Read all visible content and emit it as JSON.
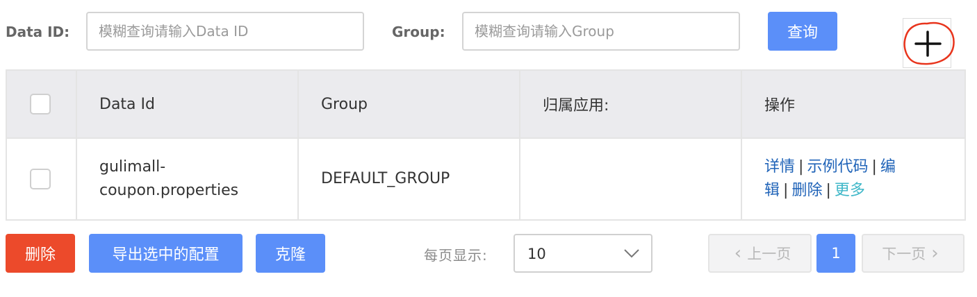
{
  "search": {
    "dataid_label": "Data ID:",
    "dataid_placeholder": "模糊查询请输入Data ID",
    "group_label": "Group:",
    "group_placeholder": "模糊查询请输入Group",
    "query_button": "查询"
  },
  "table": {
    "headers": {
      "data_id": "Data Id",
      "group": "Group",
      "app": "归属应用:",
      "ops": "操作"
    },
    "rows": [
      {
        "data_id_line1": "gulimall-",
        "data_id_line2": "coupon.properties",
        "group": "DEFAULT_GROUP",
        "app": "",
        "ops": {
          "detail": "详情",
          "sample_code": "示例代码",
          "edit_1": "编",
          "edit_2": "辑",
          "delete": "删除",
          "more": "更多",
          "separator": "|"
        }
      }
    ]
  },
  "footer": {
    "delete_button": "删除",
    "export_button": "导出选中的配置",
    "clone_button": "克隆",
    "page_size_label": "每页显示:",
    "page_size_value": "10",
    "prev_label": "上一页",
    "current_page": "1",
    "next_label": "下一页"
  },
  "colors": {
    "primary": "#5b8ff9",
    "danger": "#ec4a2b",
    "link": "#1f63b8",
    "link_alt": "#3fb7c8",
    "header_bg": "#ebebee",
    "annotation": "#e8341c"
  },
  "icons": {
    "add": "plus-icon",
    "select_arrow": "chevron-down-icon",
    "prev": "chevron-left-icon",
    "next": "chevron-right-icon"
  }
}
